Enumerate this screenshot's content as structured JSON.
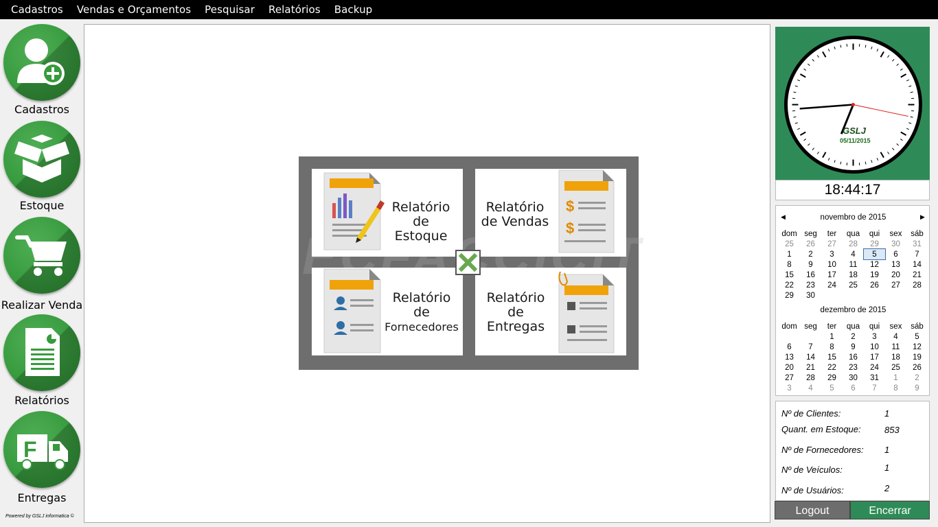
{
  "menu": [
    "Cadastros",
    "Vendas e Orçamentos",
    "Pesquisar",
    "Relatórios",
    "Backup"
  ],
  "sidebar": [
    {
      "label": "Cadastros",
      "icon": "add-user-icon"
    },
    {
      "label": "Estoque",
      "icon": "box-icon"
    },
    {
      "label": "Realizar Venda",
      "icon": "cart-icon"
    },
    {
      "label": "Relatórios",
      "icon": "report-icon"
    },
    {
      "label": "Entregas",
      "icon": "truck-icon"
    }
  ],
  "powered_by": "Powered by GSLJ informatica ©",
  "watermark": "ECFACCICIT",
  "reports": {
    "estoque": [
      "Relatório",
      "de Estoque"
    ],
    "vendas": [
      "Relatório",
      "de Vendas"
    ],
    "fornecedores": [
      "Relatório",
      "de",
      "Fornecedores"
    ],
    "entregas": [
      "Relatório",
      "de",
      "Entregas"
    ]
  },
  "clock": {
    "brand": "GSLJ",
    "date": "05/11/2015",
    "time": "18:44:17"
  },
  "calendar": {
    "weekdays": [
      "dom",
      "seg",
      "ter",
      "qua",
      "qui",
      "sex",
      "sáb"
    ],
    "months": [
      {
        "title": "novembro de 2015",
        "weeks": [
          [
            "25",
            "26",
            "27",
            "28",
            "29",
            "30",
            "31"
          ],
          [
            "1",
            "2",
            "3",
            "4",
            "5",
            "6",
            "7"
          ],
          [
            "8",
            "9",
            "10",
            "11",
            "12",
            "13",
            "14"
          ],
          [
            "15",
            "16",
            "17",
            "18",
            "19",
            "20",
            "21"
          ],
          [
            "22",
            "23",
            "24",
            "25",
            "26",
            "27",
            "28"
          ],
          [
            "29",
            "30",
            "",
            "",
            "",
            "",
            ""
          ]
        ],
        "dim_first_row": true,
        "selected": "5"
      },
      {
        "title": "dezembro de 2015",
        "weeks": [
          [
            "",
            "",
            "1",
            "2",
            "3",
            "4",
            "5"
          ],
          [
            "6",
            "7",
            "8",
            "9",
            "10",
            "11",
            "12"
          ],
          [
            "13",
            "14",
            "15",
            "16",
            "17",
            "18",
            "19"
          ],
          [
            "20",
            "21",
            "22",
            "23",
            "24",
            "25",
            "26"
          ],
          [
            "27",
            "28",
            "29",
            "30",
            "31",
            "1",
            "2"
          ],
          [
            "3",
            "4",
            "5",
            "6",
            "7",
            "8",
            "9"
          ]
        ]
      }
    ]
  },
  "stats": [
    {
      "label": "Nº de Clientes:",
      "value": "1"
    },
    {
      "label": "Quant. em Estoque:",
      "value": "853"
    },
    {
      "label": "Nº de Fornecedores:",
      "value": "1"
    },
    {
      "label": "Nº de Veículos:",
      "value": "1"
    },
    {
      "label": "Nº de Usuários:",
      "value": "2"
    }
  ],
  "buttons": {
    "logout": "Logout",
    "encerrar": "Encerrar"
  },
  "colors": {
    "green": "#2e8b57",
    "icon_green": "#379a3d",
    "dialog_gray": "#6e6e6e",
    "orange": "#f0a20a"
  }
}
